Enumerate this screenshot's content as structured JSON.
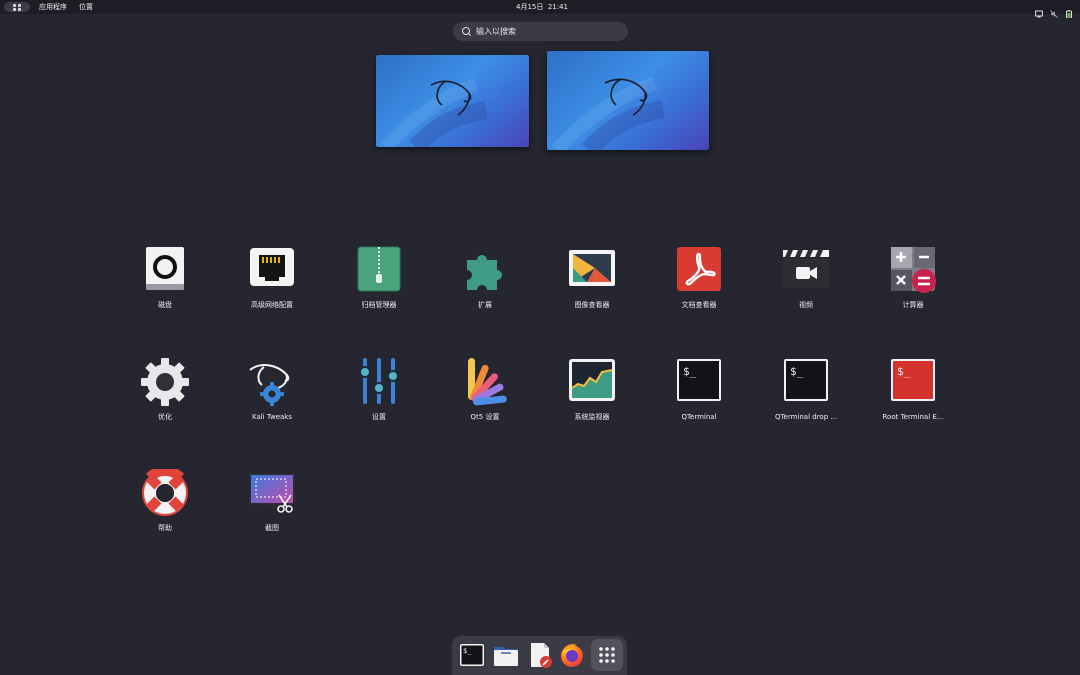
{
  "topbar": {
    "applications": "应用程序",
    "places": "位置",
    "date": "4月15日",
    "time": "21:41",
    "tray_icons": [
      "screen-icon",
      "mute-icon",
      "battery-icon"
    ]
  },
  "search": {
    "placeholder": "输入以搜索"
  },
  "apps": [
    {
      "label": "磁盘"
    },
    {
      "label": "高级网络配置"
    },
    {
      "label": "归档管理器"
    },
    {
      "label": "扩展"
    },
    {
      "label": "图像查看器"
    },
    {
      "label": "文档查看器"
    },
    {
      "label": "视频"
    },
    {
      "label": "计算器"
    },
    {
      "label": "优化"
    },
    {
      "label": "Kali Tweaks"
    },
    {
      "label": "设置"
    },
    {
      "label": "Qt5 设置"
    },
    {
      "label": "系统监视器"
    },
    {
      "label": "QTerminal"
    },
    {
      "label": "QTerminal drop ..."
    },
    {
      "label": "Root Terminal E..."
    },
    {
      "label": "帮助"
    },
    {
      "label": "截图"
    }
  ],
  "dash": [
    "terminal",
    "files",
    "text-editor",
    "firefox",
    "show-applications"
  ],
  "colors": {
    "background": "#25262f",
    "topbar": "#1d1e25",
    "accent_red": "#d93a31"
  }
}
